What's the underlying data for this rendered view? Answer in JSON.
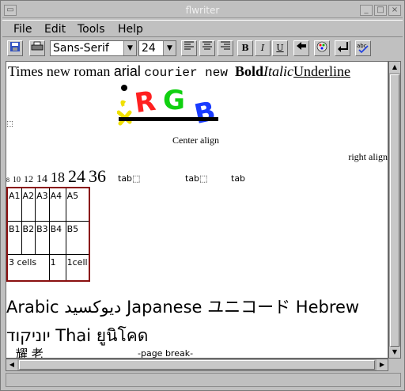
{
  "window": {
    "title": "flwriter"
  },
  "menu": [
    "File",
    "Edit",
    "Tools",
    "Help"
  ],
  "toolbar": {
    "font_family": "Sans-Serif",
    "font_size": "24",
    "bold_label": "B",
    "italic_label": "I",
    "underline_label": "U"
  },
  "document": {
    "line1": {
      "times": "Times new roman",
      "arial": "arial",
      "courier": "courier new",
      "bold": "Bold",
      "italic": "Italic",
      "underline": "Underline"
    },
    "logo_letters": [
      "R",
      "G",
      "B"
    ],
    "center_align": "Center align",
    "right_align": "right align",
    "sizes": [
      "8",
      "10",
      "12",
      "14",
      "18",
      "24",
      "36"
    ],
    "tabs": [
      "tab",
      "tab",
      "tab"
    ],
    "table": {
      "row1": [
        "A1",
        "A2",
        "A3",
        "A4",
        "A5"
      ],
      "row2": [
        "B1",
        "B2",
        "B3",
        "B4",
        "B5"
      ],
      "row3": [
        "3 cells",
        "1",
        "1cell"
      ]
    },
    "intl_line1": "Arabic ديوكسيد Japanese ユニコード Hebrew",
    "intl_line2": "יוניקוד Thai ยูนิโคด",
    "cjk": "耀 老",
    "page_break": "-page break-"
  },
  "colors": {
    "red": "#ff2020",
    "green": "#10d010",
    "blue": "#1a3cff",
    "yellow": "#f0e000",
    "table_border": "#8a1010"
  }
}
